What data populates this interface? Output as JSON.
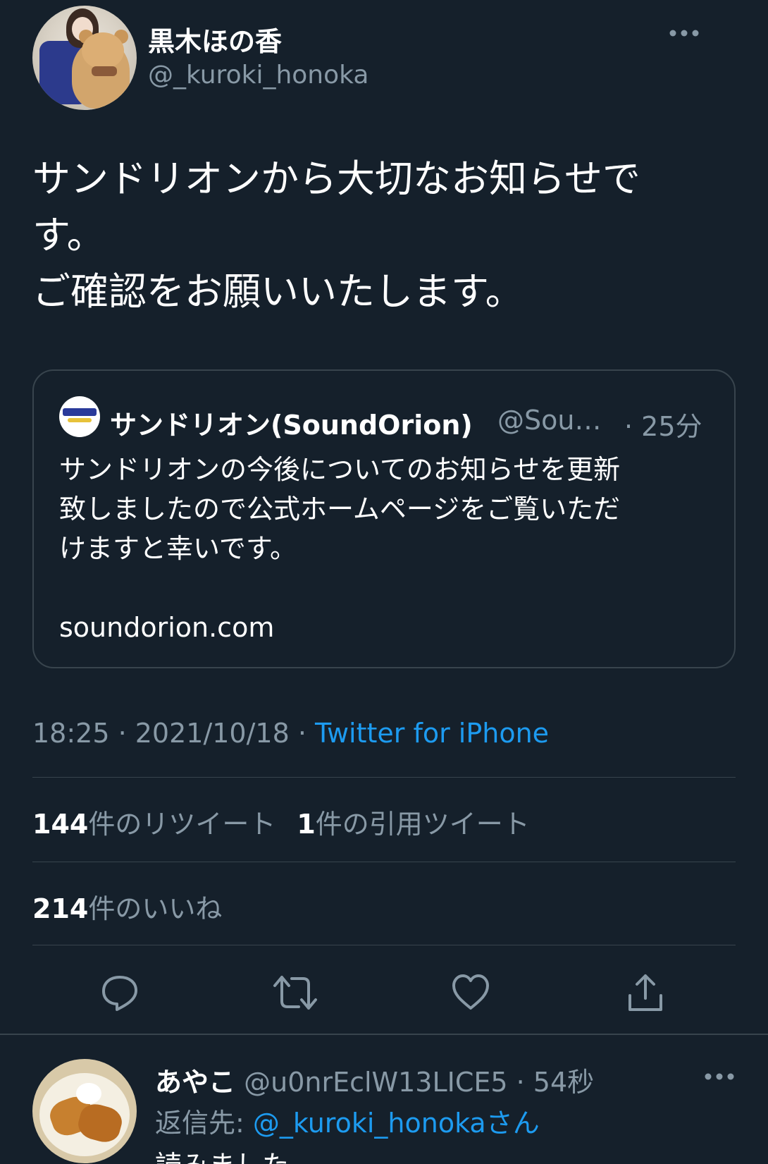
{
  "tweet": {
    "author_name": "黒木ほの香",
    "author_handle": "@_kuroki_honoka",
    "text": "サンドリオンから大切なお知らせで\nす。\nご確認をお願いいたします。",
    "timestamp": "18:25 · 2021/10/18 · ",
    "source": "Twitter for iPhone"
  },
  "quote": {
    "name": "サンドリオン(SoundOrion)",
    "handle": "@Sou…",
    "time": "· 25分",
    "text": "サンドリオンの今後についてのお知らせを更新\n致しましたので公式ホームページをご覧いただ\nけますと幸いです。",
    "link": "soundorion.com"
  },
  "stats": {
    "retweets_count": "144",
    "retweets_label": "件のリツイート",
    "quotes_count": "1",
    "quotes_label": "件の引用ツイート",
    "likes_count": "214",
    "likes_label": "件のいいね"
  },
  "actions": {
    "icons": [
      "reply-icon",
      "retweet-icon",
      "like-icon",
      "share-icon"
    ]
  },
  "reply": {
    "name": "あやこ",
    "handle": "@u0nrEclW13LICE5 · 54秒",
    "reply_to_label": "返信先: ",
    "reply_to_mention": "@_kuroki_honokaさん",
    "text": "読みました"
  },
  "colors": {
    "background": "#15202b",
    "secondary_text": "#8899a6",
    "accent": "#1d9bf0",
    "border": "#38444d"
  }
}
